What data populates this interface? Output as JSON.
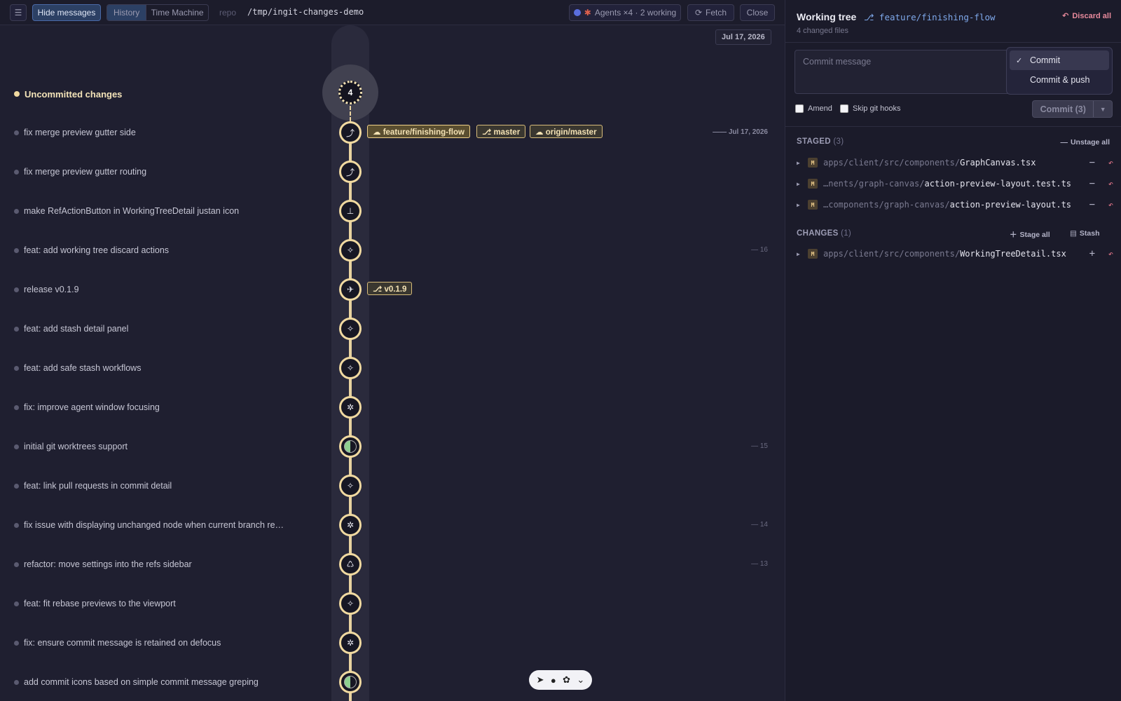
{
  "topbar": {
    "hide_messages": "Hide messages",
    "tabs": [
      "History",
      "Time Machine"
    ],
    "repo_label": "repo",
    "repo_path": "/tmp/ingit-changes-demo",
    "agents": "Agents ×4 · 2 working",
    "fetch": "Fetch",
    "close": "Close"
  },
  "graph": {
    "date_badge": "Jul 17, 2026",
    "uncommitted_label": "Uncommitted changes",
    "uncommitted_count": "4",
    "commits": [
      {
        "msg": "fix merge preview gutter side",
        "icon": "merge-icon",
        "glyph": "⤴"
      },
      {
        "msg": "fix merge preview gutter routing",
        "icon": "merge-icon",
        "glyph": "⤴"
      },
      {
        "msg": "make RefActionButton in WorkingTreeDetail justan icon",
        "icon": "pin-icon",
        "glyph": "⊥"
      },
      {
        "msg": "feat: add working tree discard actions",
        "icon": "sparkle-icon",
        "glyph": "✧"
      },
      {
        "msg": "release v0.1.9",
        "icon": "rocket-icon",
        "glyph": "✈"
      },
      {
        "msg": "feat: add stash detail panel",
        "icon": "sparkle-icon",
        "glyph": "✧"
      },
      {
        "msg": "feat: add safe stash workflows",
        "icon": "sparkle-icon",
        "glyph": "✧"
      },
      {
        "msg": "fix: improve agent window focusing",
        "icon": "bug-icon",
        "glyph": "✲"
      },
      {
        "msg": "initial git worktrees support",
        "icon": "half-circle-icon",
        "glyph": ""
      },
      {
        "msg": "feat: link pull requests in commit detail",
        "icon": "sparkle-icon",
        "glyph": "✧"
      },
      {
        "msg": "fix issue with displaying unchanged node when current branch re…",
        "icon": "bug-icon",
        "glyph": "✲"
      },
      {
        "msg": "refactor: move settings into the refs sidebar",
        "icon": "recycle-icon",
        "glyph": "♺"
      },
      {
        "msg": "feat: fit rebase previews to the viewport",
        "icon": "sparkle-icon",
        "glyph": "✧"
      },
      {
        "msg": "fix: ensure commit message is retained on defocus",
        "icon": "bug-icon",
        "glyph": "✲"
      },
      {
        "msg": "add commit icons based on simple commit message greping",
        "icon": "half-circle-icon",
        "glyph": ""
      }
    ],
    "refs": {
      "feature": "☁ feature/finishing-flow",
      "master": "⎇ master",
      "origin": "☁ origin/master",
      "tag": "⎇ v0.1.9"
    },
    "side_dates": [
      "—— Jul 17, 2026",
      "— 16",
      "— 15",
      "— 14",
      "— 13"
    ]
  },
  "panel": {
    "title": "Working tree",
    "branch": "⎇ feature/finishing-flow",
    "subtitle": "4 changed files",
    "discard_all": "Discard all",
    "commit_placeholder": "Commit message",
    "dropdown": {
      "items": [
        "Commit",
        "Commit & push"
      ],
      "check": "✓"
    },
    "amend": "Amend",
    "skip_hooks": "Skip git hooks",
    "commit_button": "Commit (3)",
    "staged": {
      "label": "STAGED",
      "count": "(3)",
      "action": "Unstage all",
      "files": [
        {
          "dir": "apps/client/src/components/",
          "name": "GraphCanvas.tsx"
        },
        {
          "dir": "…nents/graph-canvas/",
          "name": "action-preview-layout.test.ts"
        },
        {
          "dir": "…components/graph-canvas/",
          "name": "action-preview-layout.ts"
        }
      ]
    },
    "changes": {
      "label": "CHANGES",
      "count": "(1)",
      "stage_all": "Stage all",
      "stash": "Stash",
      "files": [
        {
          "dir": "apps/client/src/components/",
          "name": "WorkingTreeDetail.tsx"
        }
      ]
    },
    "status_badge": "M"
  }
}
